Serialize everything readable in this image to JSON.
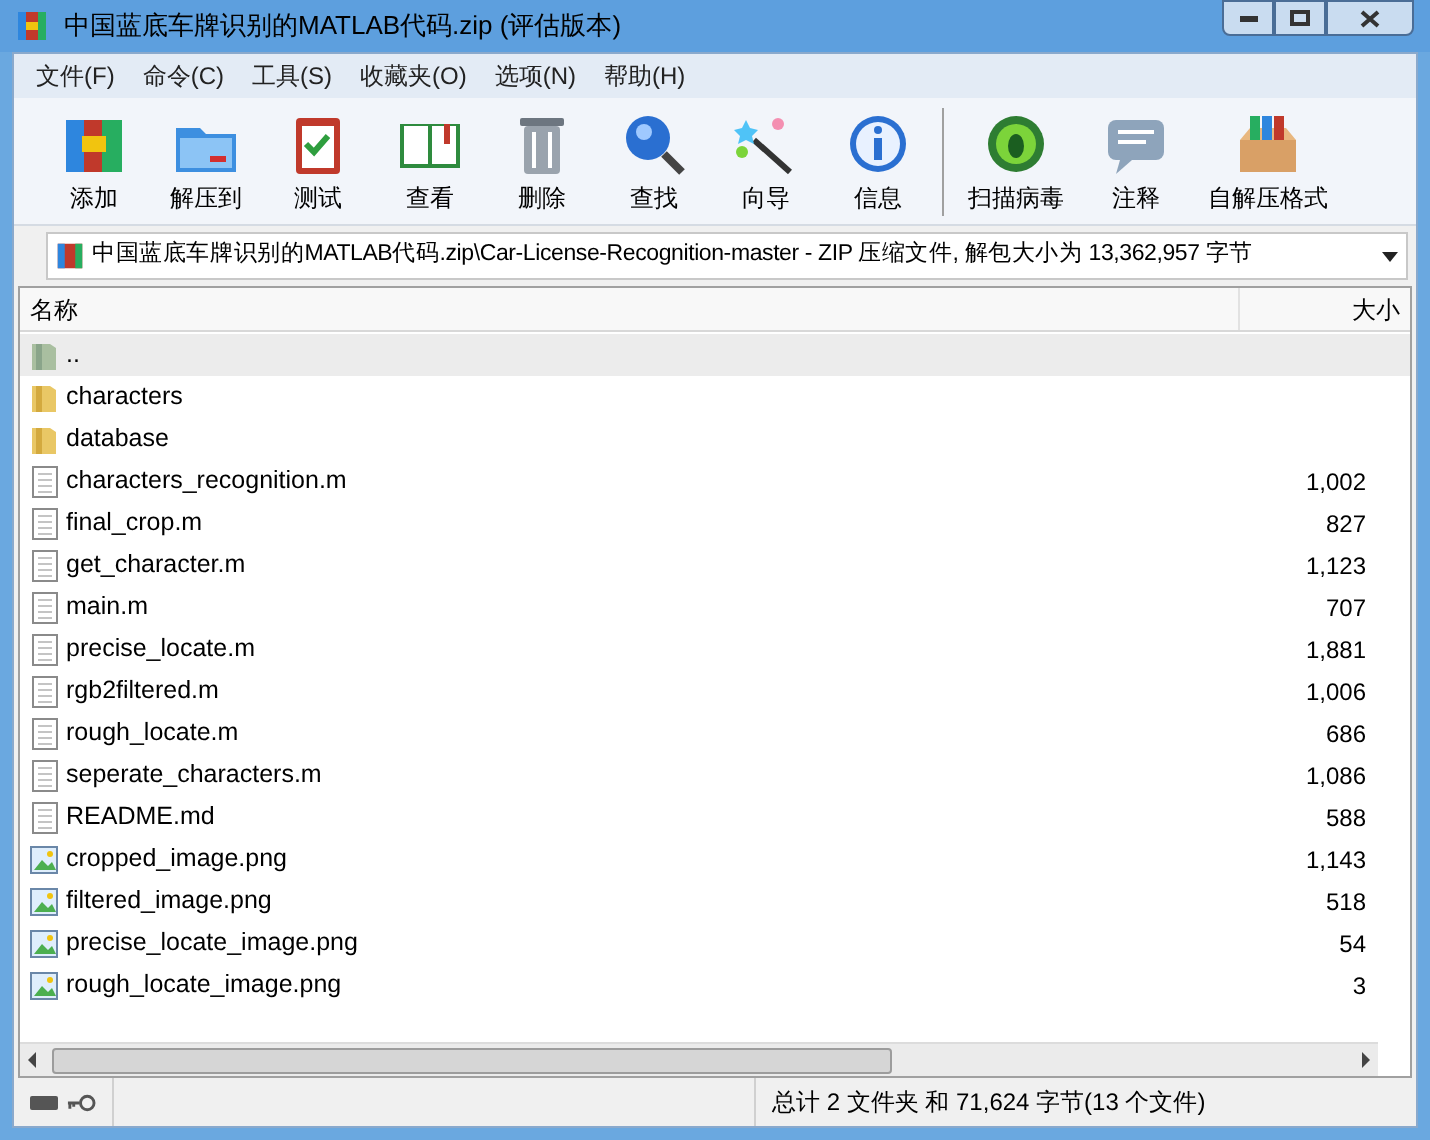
{
  "window": {
    "title": "中国蓝底车牌识别的MATLAB代码.zip (评估版本)"
  },
  "menu": [
    "文件(F)",
    "命令(C)",
    "工具(S)",
    "收藏夹(O)",
    "选项(N)",
    "帮助(H)"
  ],
  "toolbar": [
    {
      "label": "添加"
    },
    {
      "label": "解压到"
    },
    {
      "label": "测试"
    },
    {
      "label": "查看"
    },
    {
      "label": "删除"
    },
    {
      "label": "查找"
    },
    {
      "label": "向导"
    },
    {
      "label": "信息"
    },
    {
      "label": "扫描病毒",
      "group_start": true
    },
    {
      "label": "注释"
    },
    {
      "label": "自解压格式"
    }
  ],
  "address": "中国蓝底车牌识别的MATLAB代码.zip\\Car-License-Recognition-master - ZIP 压缩文件, 解包大小为 13,362,957 字节",
  "table": {
    "columns": [
      "名称",
      "大小"
    ],
    "rows": [
      {
        "kind": "parent",
        "name": "..",
        "size": "",
        "selected": true
      },
      {
        "kind": "folder",
        "name": "characters",
        "size": "",
        "selected": false
      },
      {
        "kind": "folder",
        "name": "database",
        "size": "",
        "selected": false
      },
      {
        "kind": "file",
        "name": "characters_recognition.m",
        "size": "1,002",
        "selected": false
      },
      {
        "kind": "file",
        "name": "final_crop.m",
        "size": "827",
        "selected": false
      },
      {
        "kind": "file",
        "name": "get_character.m",
        "size": "1,123",
        "selected": false
      },
      {
        "kind": "file",
        "name": "main.m",
        "size": "707",
        "selected": false
      },
      {
        "kind": "file",
        "name": "precise_locate.m",
        "size": "1,881",
        "selected": false
      },
      {
        "kind": "file",
        "name": "rgb2filtered.m",
        "size": "1,006",
        "selected": false
      },
      {
        "kind": "file",
        "name": "rough_locate.m",
        "size": "686",
        "selected": false
      },
      {
        "kind": "file",
        "name": "seperate_characters.m",
        "size": "1,086",
        "selected": false
      },
      {
        "kind": "file",
        "name": "README.md",
        "size": "588",
        "selected": false
      },
      {
        "kind": "image",
        "name": "cropped_image.png",
        "size": "1,143",
        "selected": false
      },
      {
        "kind": "image",
        "name": "filtered_image.png",
        "size": "518",
        "selected": false
      },
      {
        "kind": "image",
        "name": "precise_locate_image.png",
        "size": "54",
        "selected": false
      },
      {
        "kind": "image",
        "name": "rough_locate_image.png",
        "size": "3",
        "selected": false
      }
    ]
  },
  "status_bar": "总计 2 文件夹 和 71,624 字节(13 个文件)"
}
